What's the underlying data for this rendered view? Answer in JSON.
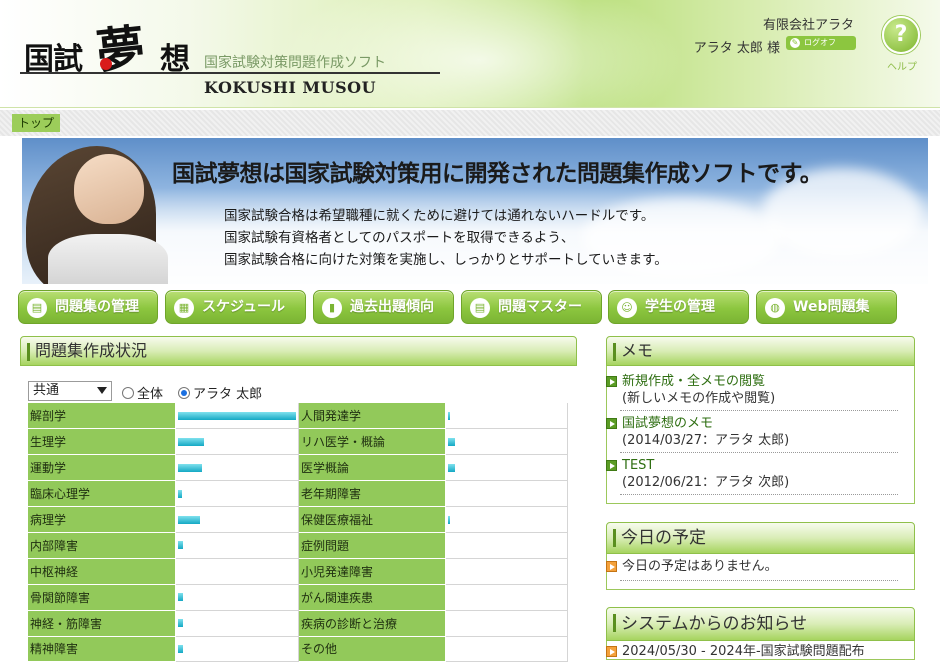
{
  "header": {
    "logo_prefix": "国試",
    "logo_big": "夢",
    "logo_suffix": "想",
    "logo_subtitle": "国家試験対策問題作成ソフト",
    "logo_english": "KOKUSHI MUSOU",
    "company": "有限会社アラタ",
    "user": "アラタ 太郎 様",
    "logout_label": "ログオフ",
    "help_symbol": "?",
    "help_label": "ヘルプ"
  },
  "breadcrumb": {
    "label": "トップ"
  },
  "banner": {
    "title": "国試夢想は国家試験対策用に開発された問題集作成ソフトです。",
    "lines": [
      "国家試験合格は希望職種に就くために避けては通れないハードルです。",
      "国家試験有資格者としてのパスポートを取得できるよう、",
      "国家試験合格に向けた対策を実施し、しっかりとサポートしていきます。"
    ]
  },
  "nav": [
    {
      "label": "問題集の管理",
      "icon": "book-icon"
    },
    {
      "label": "スケジュール",
      "icon": "calendar-icon"
    },
    {
      "label": "過去出題傾向",
      "icon": "chart-icon"
    },
    {
      "label": "問題マスター",
      "icon": "document-icon"
    },
    {
      "label": "学生の管理",
      "icon": "student-icon"
    },
    {
      "label": "Web問題集",
      "icon": "globe-icon"
    }
  ],
  "status": {
    "title": "問題集作成状況",
    "select_value": "共通",
    "radio_all": "全体",
    "radio_user": "アラタ 太郎",
    "radio_user_selected": true,
    "rows": [
      {
        "left": "解剖学",
        "left_level": 1.0,
        "right": "人間発達学",
        "right_level": 0.01
      },
      {
        "left": "生理学",
        "left_level": 0.22,
        "right": "リハ医学・概論",
        "right_level": 0.06
      },
      {
        "left": "運動学",
        "left_level": 0.2,
        "right": "医学概論",
        "right_level": 0.06
      },
      {
        "left": "臨床心理学",
        "left_level": 0.03,
        "right": "老年期障害",
        "right_level": 0
      },
      {
        "left": "病理学",
        "left_level": 0.19,
        "right": "保健医療福祉",
        "right_level": 0.01
      },
      {
        "left": "内部障害",
        "left_level": 0.04,
        "right": "症例問題",
        "right_level": 0
      },
      {
        "left": "中枢神経",
        "left_level": 0,
        "right": "小児発達障害",
        "right_level": 0
      },
      {
        "left": "骨関節障害",
        "left_level": 0.04,
        "right": "がん関連疾患",
        "right_level": 0
      },
      {
        "left": "神経・筋障害",
        "left_level": 0.04,
        "right": "疾病の診断と治療",
        "right_level": 0
      },
      {
        "left": "精神障害",
        "left_level": 0.04,
        "right": "その他",
        "right_level": 0
      }
    ]
  },
  "memo": {
    "title": "メモ",
    "items": [
      {
        "title": "新規作成・全メモの閲覧",
        "sub": "(新しいメモの作成や閲覧)"
      },
      {
        "title": "国試夢想のメモ",
        "sub": "(2014/03/27：アラタ 太郎)"
      },
      {
        "title": "TEST",
        "sub": "(2012/06/21：アラタ 次郎)"
      }
    ]
  },
  "today": {
    "title": "今日の予定",
    "empty": "今日の予定はありません。"
  },
  "notices": {
    "title": "システムからのお知らせ",
    "first": "2024/05/30 - 2024年-国家試験問題配布"
  }
}
